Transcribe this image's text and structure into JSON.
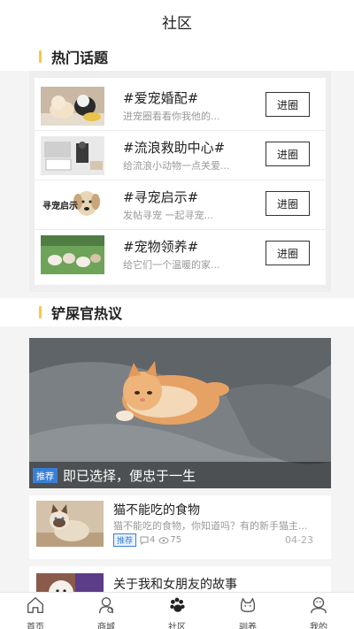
{
  "header": {
    "title": "社区"
  },
  "hot_topics": {
    "heading": "热门话题",
    "items": [
      {
        "name": "#爱宠婚配#",
        "desc": "进宠圈看看你我他的...",
        "button": "进圈"
      },
      {
        "name": "#流浪救助中心#",
        "desc": "给流浪小动物一点关爱...",
        "button": "进圈"
      },
      {
        "name": "#寻宠启示#",
        "desc": "发帖寻宠 一起寻宠...",
        "button": "进圈",
        "thumb_text": "寻宠启示"
      },
      {
        "name": "#宠物领养#",
        "desc": "给它们一个温暖的家...",
        "button": "进圈"
      }
    ]
  },
  "discussion": {
    "heading": "铲屎官热议",
    "banner": {
      "tag": "推荐",
      "caption": "即已选择，便忠于一生"
    },
    "posts": [
      {
        "title": "猫不能吃的食物",
        "desc": "猫不能吃的食物，你知道吗？有的新手猫主...",
        "tag": "推荐",
        "comments": "4",
        "views": "75",
        "date": "04-23"
      },
      {
        "title": "关于我和女朋友的故事"
      }
    ]
  },
  "tabbar": {
    "items": [
      {
        "label": "首页",
        "icon": "home-icon"
      },
      {
        "label": "商城",
        "icon": "shop-icon"
      },
      {
        "label": "社区",
        "icon": "paw-icon",
        "active": true
      },
      {
        "label": "驯养",
        "icon": "dog-icon"
      },
      {
        "label": "我的",
        "icon": "user-icon"
      }
    ]
  },
  "colors": {
    "accent": "#f5c84a",
    "tag_blue": "#3a7fd5"
  }
}
